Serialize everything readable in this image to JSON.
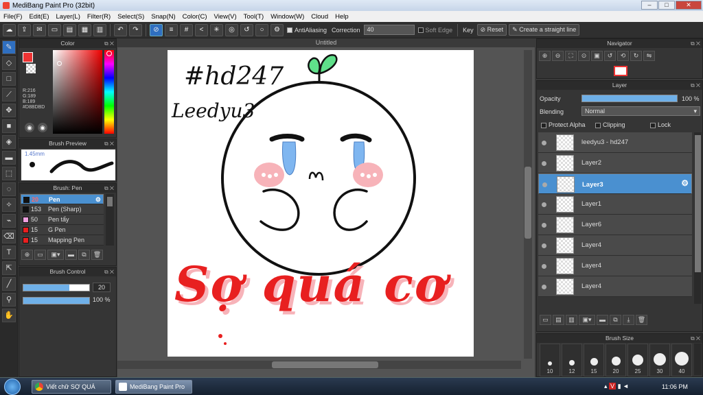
{
  "window": {
    "title": "MediBang Paint Pro (32bit)"
  },
  "menu": [
    "File(F)",
    "Edit(E)",
    "Layer(L)",
    "Filter(R)",
    "Select(S)",
    "Snap(N)",
    "Color(C)",
    "View(V)",
    "Tool(T)",
    "Window(W)",
    "Cloud",
    "Help"
  ],
  "toolbar": {
    "antialiasing": "AntiAliasing",
    "correction_label": "Correction",
    "correction_value": "40",
    "soft_edge": "Soft Edge",
    "key": "Key",
    "reset": "Reset",
    "straight_line": "Create a straight line"
  },
  "color_panel": {
    "title": "Color",
    "r": "R:216",
    "g": "G:189",
    "b": "B:189",
    "hex": "#D8BDBD",
    "primary": "#D8BDBD"
  },
  "brush_preview": {
    "title": "Brush Preview",
    "size": "1.45mm"
  },
  "brush_panel": {
    "title": "Brush: Pen",
    "items": [
      {
        "size": "20",
        "name": "Pen",
        "color": "#111111",
        "selected": true
      },
      {
        "size": "153",
        "name": "Pen (Sharp)",
        "color": "#111111"
      },
      {
        "size": "50",
        "name": "Pen tẩy",
        "color": "#f0a0e0"
      },
      {
        "size": "15",
        "name": "G Pen",
        "color": "#e82020"
      },
      {
        "size": "15",
        "name": "Mapping Pen",
        "color": "#e82020"
      }
    ]
  },
  "brush_control": {
    "title": "Brush Control",
    "size": "20",
    "opacity": "100 %",
    "size_fraction": 0.7,
    "opacity_fraction": 1.0
  },
  "canvas": {
    "title": "Untitled",
    "text_tag": "#hd247",
    "text_name": "Leedyu3",
    "text_slogan": "Sợ quá cơ"
  },
  "navigator": {
    "title": "Navigator"
  },
  "layer_panel": {
    "title": "Layer",
    "opacity_label": "Opacity",
    "opacity_value": "100 %",
    "blending_label": "Blending",
    "blending_value": "Normal",
    "protect_alpha": "Protect Alpha",
    "clipping": "Clipping",
    "lock": "Lock",
    "layers": [
      {
        "name": "leedyu3 - hd247"
      },
      {
        "name": "Layer2"
      },
      {
        "name": "Layer3",
        "selected": true
      },
      {
        "name": "Layer1"
      },
      {
        "name": "Layer6"
      },
      {
        "name": "Layer4"
      },
      {
        "name": "Layer4"
      },
      {
        "name": "Layer4"
      }
    ]
  },
  "brush_size": {
    "title": "Brush Size",
    "sizes": [
      "10",
      "12",
      "15",
      "20",
      "25",
      "30",
      "40"
    ]
  },
  "taskbar": {
    "item1": "Viết chữ SỢ QUÁ CƠ...",
    "item2": "MediBang Paint Pro ...",
    "clock": "11:06 PM"
  }
}
